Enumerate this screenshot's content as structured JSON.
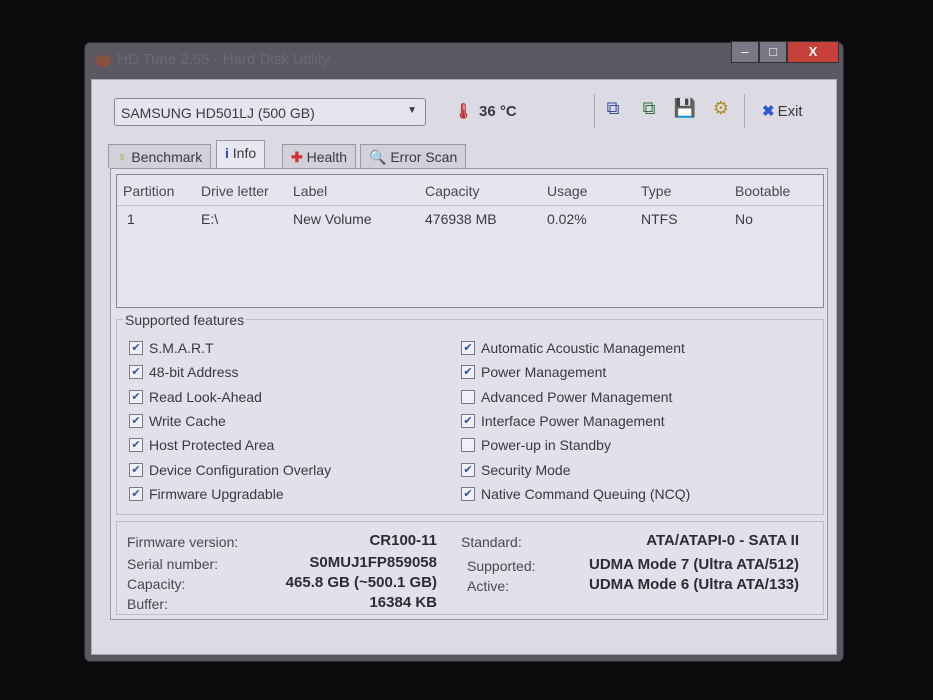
{
  "window": {
    "title": "HD Tune 2.55 - Hard Disk Utility",
    "min": "–",
    "max": "□",
    "close": "X"
  },
  "toolbar": {
    "drive": "SAMSUNG HD501LJ (500 GB)",
    "temperature": "36 °C",
    "exit": "Exit"
  },
  "tabs": [
    "Benchmark",
    "Info",
    "Health",
    "Error Scan"
  ],
  "partitions": {
    "headers": [
      "Partition",
      "Drive letter",
      "Label",
      "Capacity",
      "Usage",
      "Type",
      "Bootable"
    ],
    "rows": [
      [
        "1",
        "E:\\",
        "New Volume",
        "476938 MB",
        "0.02%",
        "NTFS",
        "No"
      ]
    ]
  },
  "features": {
    "title": "Supported features",
    "left": [
      {
        "label": "S.M.A.R.T",
        "checked": true
      },
      {
        "label": "48-bit Address",
        "checked": true
      },
      {
        "label": "Read Look-Ahead",
        "checked": true
      },
      {
        "label": "Write Cache",
        "checked": true
      },
      {
        "label": "Host Protected Area",
        "checked": true
      },
      {
        "label": "Device Configuration Overlay",
        "checked": true
      },
      {
        "label": "Firmware Upgradable",
        "checked": true
      }
    ],
    "right": [
      {
        "label": "Automatic Acoustic Management",
        "checked": true
      },
      {
        "label": "Power Management",
        "checked": true
      },
      {
        "label": "Advanced Power Management",
        "checked": false
      },
      {
        "label": "Interface Power Management",
        "checked": true
      },
      {
        "label": "Power-up in Standby",
        "checked": false
      },
      {
        "label": "Security Mode",
        "checked": true
      },
      {
        "label": "Native Command Queuing (NCQ)",
        "checked": true
      }
    ]
  },
  "details": {
    "firmware_label": "Firmware version:",
    "firmware": "CR100-11",
    "serial_label": "Serial number:",
    "serial": "S0MUJ1FP859058",
    "capacity_label": "Capacity:",
    "capacity": "465.8 GB (~500.1 GB)",
    "buffer_label": "Buffer:",
    "buffer": "16384 KB",
    "standard_label": "Standard:",
    "standard": "ATA/ATAPI-0 - SATA II",
    "supported_label": "Supported:",
    "supported": "UDMA Mode 7 (Ultra ATA/512)",
    "active_label": "Active:",
    "active": "UDMA Mode 6 (Ultra ATA/133)"
  }
}
